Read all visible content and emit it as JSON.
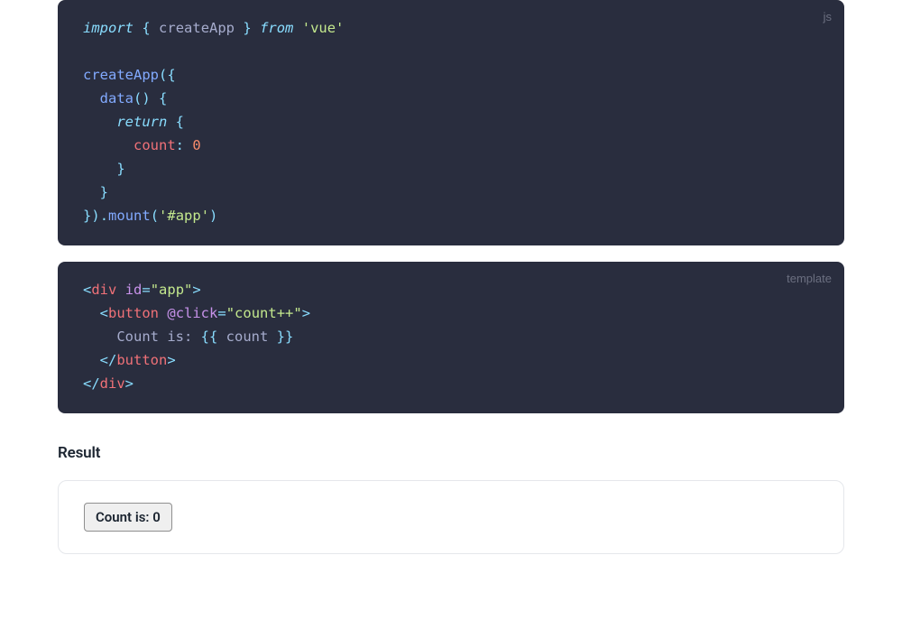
{
  "code_js": {
    "lang_label": "js",
    "tokens": {
      "import_kw": "import",
      "brace_open": "{",
      "createApp_id": "createApp",
      "brace_close": "}",
      "from_kw": "from",
      "vue_str": "'vue'",
      "createApp_call": "createApp",
      "paren_open": "(",
      "obj_open": "{",
      "data_method": "data",
      "data_paren": "()",
      "data_body_open": "{",
      "return_kw": "return",
      "return_obj_open": "{",
      "count_prop": "count",
      "colon": ":",
      "zero": "0",
      "return_obj_close": "}",
      "data_body_close": "}",
      "obj_close": "}",
      "paren_close": ")",
      "dot": ".",
      "mount_fn": "mount",
      "mount_paren_open": "(",
      "app_str": "'#app'",
      "mount_paren_close": ")"
    }
  },
  "code_template": {
    "lang_label": "template",
    "tokens": {
      "l1_open": "<",
      "l1_div": "div",
      "l1_id_attr": "id",
      "l1_eq": "=",
      "l1_id_val": "\"app\"",
      "l1_close": ">",
      "l2_open": "<",
      "l2_button": "button",
      "l2_click_attr": "@click",
      "l2_eq": "=",
      "l2_click_val": "\"count++\"",
      "l2_close": ">",
      "l3_text": "Count is: ",
      "l3_interp_open": "{{",
      "l3_count": " count ",
      "l3_interp_close": "}}",
      "l4_open": "</",
      "l4_button": "button",
      "l4_close": ">",
      "l5_open": "</",
      "l5_div": "div",
      "l5_close": ">"
    }
  },
  "result": {
    "heading": "Result",
    "button_label": "Count is: 0"
  }
}
